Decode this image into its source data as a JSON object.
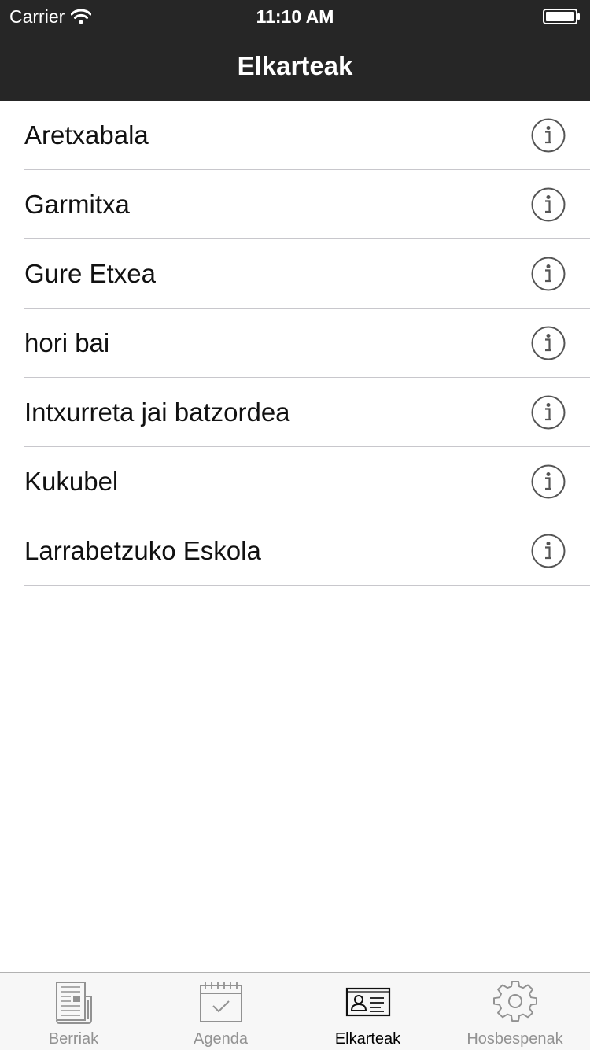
{
  "status_bar": {
    "carrier": "Carrier",
    "time": "11:10 AM"
  },
  "nav": {
    "title": "Elkarteak"
  },
  "list": {
    "items": [
      {
        "label": "Aretxabala"
      },
      {
        "label": "Garmitxa"
      },
      {
        "label": "Gure Etxea"
      },
      {
        "label": "hori bai"
      },
      {
        "label": "Intxurreta jai batzordea"
      },
      {
        "label": "Kukubel"
      },
      {
        "label": "Larrabetzuko Eskola"
      }
    ]
  },
  "tab_bar": {
    "tabs": [
      {
        "label": "Berriak",
        "icon": "newspaper-icon"
      },
      {
        "label": "Agenda",
        "icon": "calendar-icon"
      },
      {
        "label": "Elkarteak",
        "icon": "id-card-icon",
        "active": true
      },
      {
        "label": "Hosbespenak",
        "icon": "gear-icon"
      }
    ]
  },
  "colors": {
    "nav_background": "#262626",
    "separator": "#c8c7cc",
    "tab_inactive": "#929292",
    "tab_active": "#000000"
  }
}
